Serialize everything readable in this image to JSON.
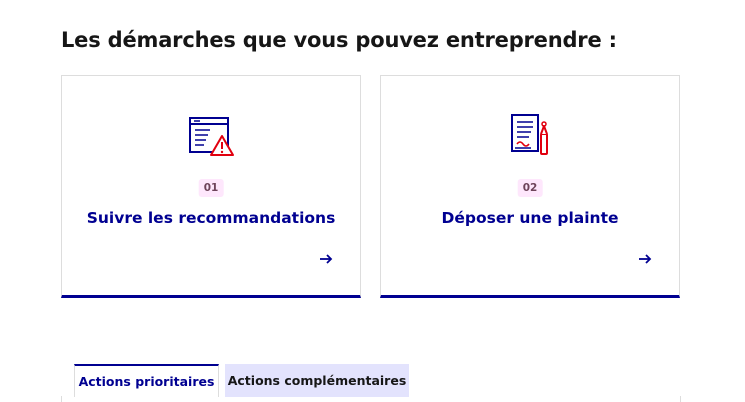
{
  "section": {
    "title": "Les démarches que vous pouvez entreprendre :"
  },
  "cards": [
    {
      "number": "01",
      "title": "Suivre les recommandations",
      "icon": "warning-document-pictogram",
      "arrow_icon": "arrow-right-icon"
    },
    {
      "number": "02",
      "title": "Déposer une plainte",
      "icon": "complaint-document-pen-pictogram",
      "arrow_icon": "arrow-right-icon"
    }
  ],
  "tabs": [
    {
      "label": "Actions prioritaires",
      "selected": true
    },
    {
      "label": "Actions complémentaires",
      "selected": false
    }
  ],
  "colors": {
    "primary": "#000091",
    "accent_red": "#e1000f",
    "badge_bg": "#fee7fc",
    "tab_inactive_bg": "#e3e3fd"
  }
}
